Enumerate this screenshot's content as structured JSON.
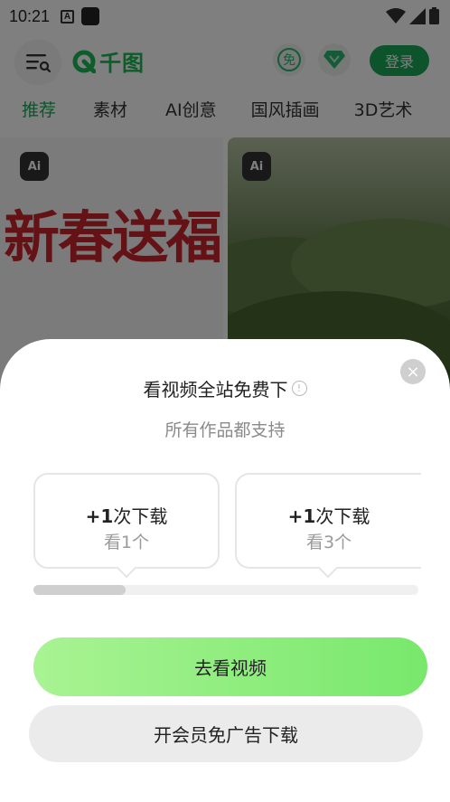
{
  "status_bar": {
    "time": "10:21",
    "icon_a": "A"
  },
  "header": {
    "logo_text": "千图",
    "free_label": "免",
    "login_label": "登录"
  },
  "tabs": [
    "推荐",
    "素材",
    "AI创意",
    "国风插画",
    "3D艺术"
  ],
  "feed": {
    "badge": "Ai",
    "left_art_text": "新春送福"
  },
  "sheet": {
    "title": "看视频全站免费下",
    "info_icon": "!",
    "subtitle": "所有作品都支持",
    "close_icon": "×",
    "options": [
      {
        "count_prefix": "+1",
        "count_suffix": "次下载",
        "requirement": "看1个"
      },
      {
        "count_prefix": "+1",
        "count_suffix": "次下载",
        "requirement": "看3个"
      }
    ],
    "progress": 0.24,
    "watch_label": "去看视频",
    "member_label": "开会员免广告下载"
  },
  "colors": {
    "brand_green": "#1aa95a",
    "button_green_start": "#a9f393",
    "button_green_end": "#78e86c"
  },
  "icons": [
    "menu-search-icon",
    "logo-icon",
    "free-icon",
    "diamond-icon",
    "wifi-icon",
    "signal-icon",
    "battery-icon",
    "close-icon",
    "info-icon"
  ]
}
